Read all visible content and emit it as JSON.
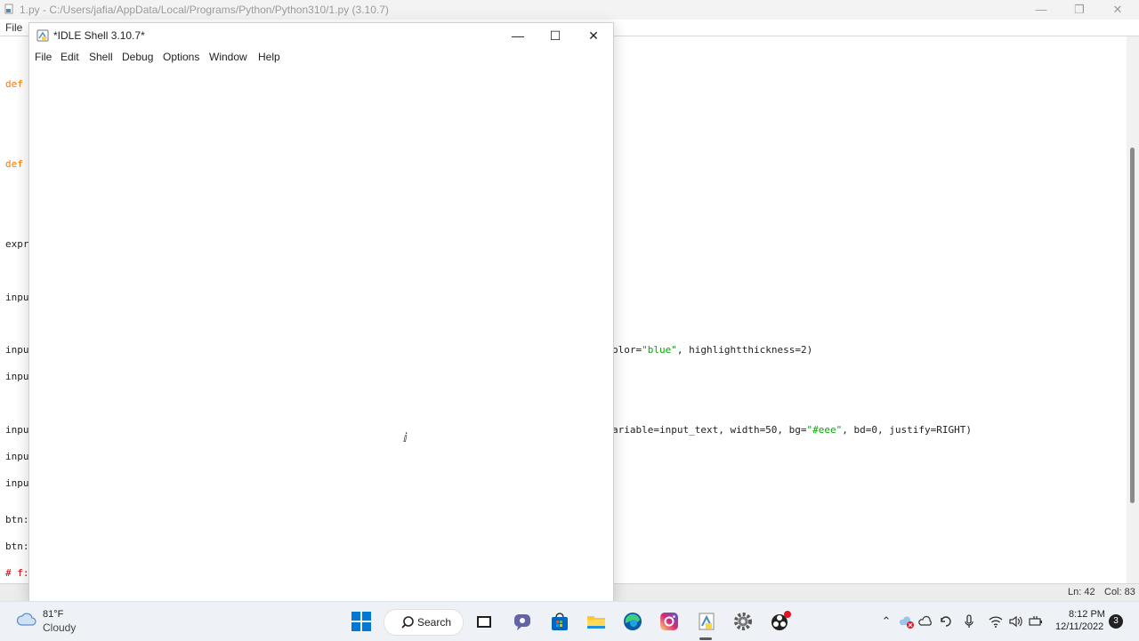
{
  "editor": {
    "title": "1.py - C:/Users/jafia/AppData/Local/Programs/Python/Python310/1.py (3.10.7)",
    "menu_file": "File",
    "status_line": "Ln: 42",
    "status_col": "Col: 83",
    "code_left": [
      {
        "text": "def",
        "kind": "kw"
      },
      {
        "text": "def",
        "kind": "kw"
      },
      {
        "text": "expr",
        "kind": "plain"
      },
      {
        "text": "inpu",
        "kind": "plain"
      },
      {
        "text": "inpu",
        "kind": "plain"
      },
      {
        "text": "inpu",
        "kind": "plain"
      },
      {
        "text": "inpu",
        "kind": "plain"
      },
      {
        "text": "inpu",
        "kind": "plain"
      },
      {
        "text": "inpu",
        "kind": "plain"
      },
      {
        "text": "btn:",
        "kind": "plain"
      },
      {
        "text": "btn:",
        "kind": "plain"
      },
      {
        "text": "# f:",
        "kind": "cmt"
      }
    ],
    "code_right_1": {
      "a": "olor=",
      "s": "\"blue\"",
      "b": ", highlightthickness=2)"
    },
    "code_right_2": {
      "a": "ariable=input_text, width=50, bg=",
      "s": "\"#eee\"",
      "b": ", bd=0, justify=RIGHT)"
    }
  },
  "shell": {
    "title": "*IDLE Shell 3.10.7*",
    "menu": [
      "File",
      "Edit",
      "Shell",
      "Debug",
      "Options",
      "Window",
      "Help"
    ]
  },
  "taskbar": {
    "weather_temp": "81°F",
    "weather_desc": "Cloudy",
    "search_label": "Search",
    "clock_time": "8:12 PM",
    "clock_date": "12/11/2022",
    "notification_count": "3"
  },
  "colors": {
    "keyword": "#ff7700",
    "string": "#00aa00",
    "comment": "#dd0000",
    "windows_blue": "#0078d4"
  }
}
